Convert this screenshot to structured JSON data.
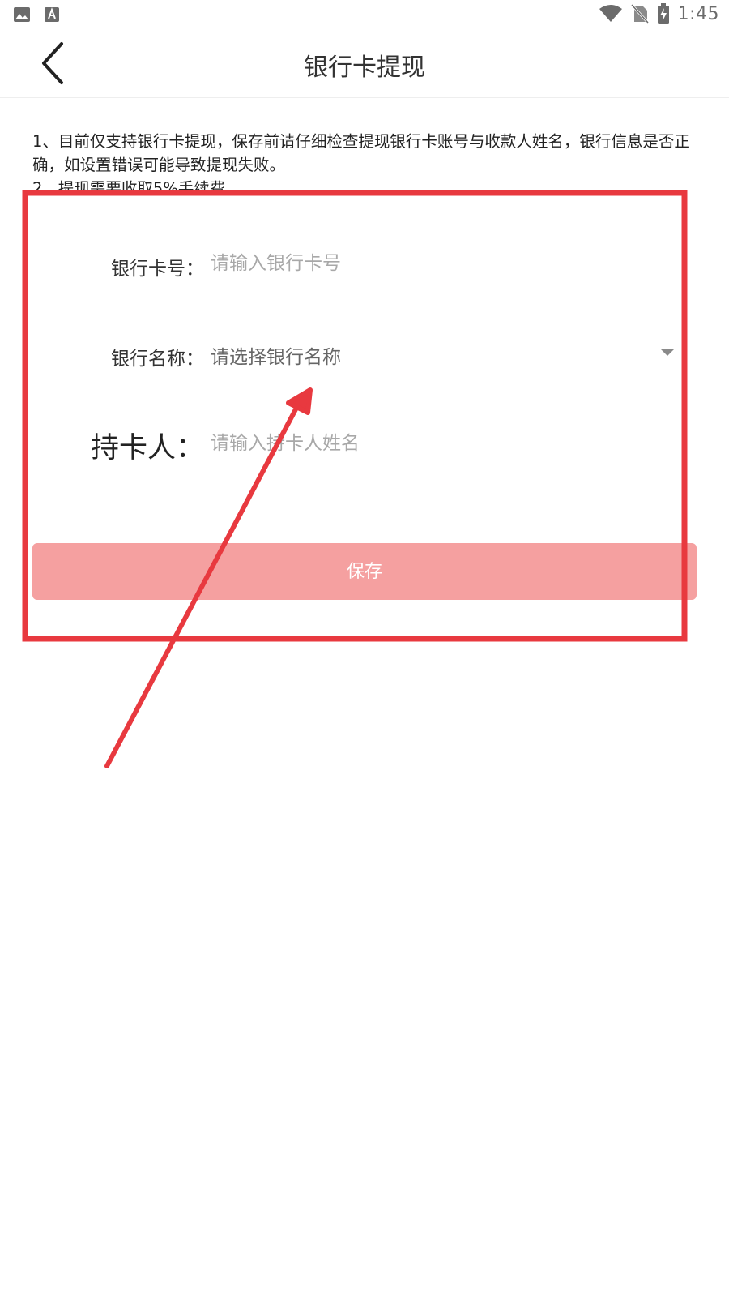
{
  "status_bar": {
    "time": "1:45",
    "left_icons": [
      "image-icon",
      "font-icon"
    ],
    "right_icons": [
      "wifi-icon",
      "no-sim-icon",
      "battery-charging-icon"
    ]
  },
  "app_bar": {
    "title": "银行卡提现",
    "back_icon": "chevron-left-icon"
  },
  "notice": {
    "line1": "1、目前仅支持银行卡提现，保存前请仔细检查提现银行卡账号与收款人姓名，银行信息是否正确，如设置错误可能导致提现失败。",
    "line2": "2、提现需要收取5%手续费。"
  },
  "form": {
    "card_number": {
      "label": "银行卡号：",
      "placeholder": "请输入银行卡号"
    },
    "bank_name": {
      "label": "银行名称：",
      "selected": "请选择银行名称"
    },
    "holder": {
      "label": "持卡人：",
      "placeholder": "请输入持卡人姓名"
    },
    "save_label": "保存"
  },
  "colors": {
    "button_bg": "#f5a0a0",
    "annotation": "#e8393f"
  }
}
